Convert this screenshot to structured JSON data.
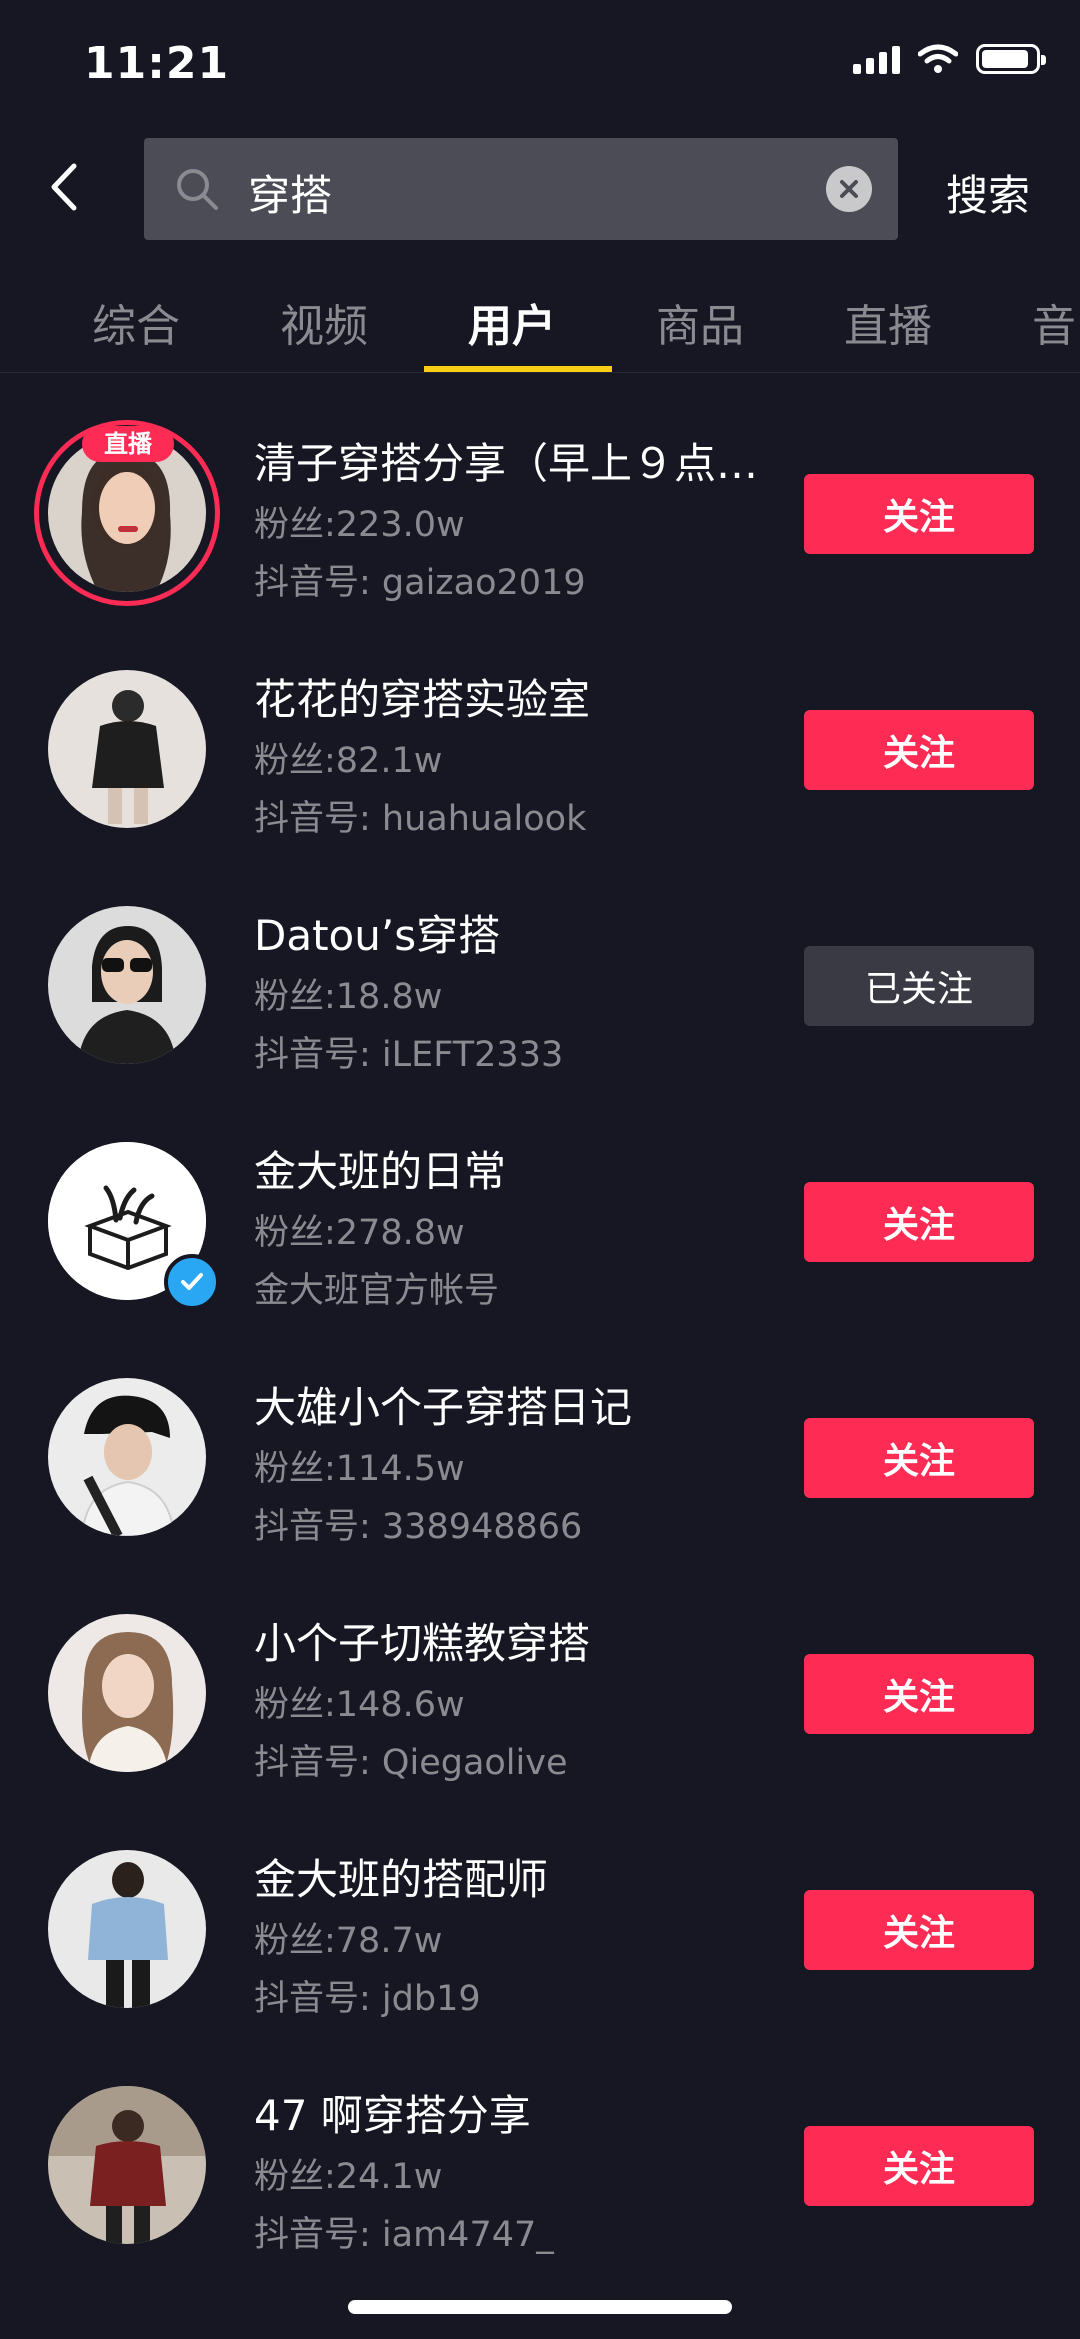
{
  "status_bar": {
    "time": "11:21"
  },
  "search": {
    "query": "穿搭",
    "submit_label": "搜索"
  },
  "tabs": [
    {
      "label": "综合"
    },
    {
      "label": "视频"
    },
    {
      "label": "用户"
    },
    {
      "label": "商品"
    },
    {
      "label": "直播"
    },
    {
      "label": "音"
    }
  ],
  "live_badge": "直播",
  "users": [
    {
      "name": "清子穿搭分享（早上９点…",
      "fans": "粉丝:223.0w",
      "uid": "抖音号: gaizao2019",
      "follow": "关注"
    },
    {
      "name": "花花的穿搭实验室",
      "fans": "粉丝:82.1w",
      "uid": "抖音号: huahualook",
      "follow": "关注"
    },
    {
      "name": "Datou’s穿搭",
      "fans": "粉丝:18.8w",
      "uid": "抖音号: iLEFT2333",
      "follow": "已关注"
    },
    {
      "name": "金大班的日常",
      "fans": "粉丝:278.8w",
      "uid": "金大班官方帐号",
      "follow": "关注"
    },
    {
      "name": "大雄小个子穿搭日记",
      "fans": "粉丝:114.5w",
      "uid": "抖音号: 338948866",
      "follow": "关注"
    },
    {
      "name": "小个子切糕教穿搭",
      "fans": "粉丝:148.6w",
      "uid": "抖音号: Qiegaolive",
      "follow": "关注"
    },
    {
      "name": "金大班的搭配师",
      "fans": "粉丝:78.7w",
      "uid": "抖音号: jdb19",
      "follow": "关注"
    },
    {
      "name": "47 啊穿搭分享",
      "fans": "粉丝:24.1w",
      "uid": "抖音号: iam4747_",
      "follow": "关注"
    }
  ],
  "colors": {
    "background": "#161722",
    "accent": "#fe2c55",
    "tab_indicator": "#face15",
    "muted_text": "#8a8b91"
  }
}
